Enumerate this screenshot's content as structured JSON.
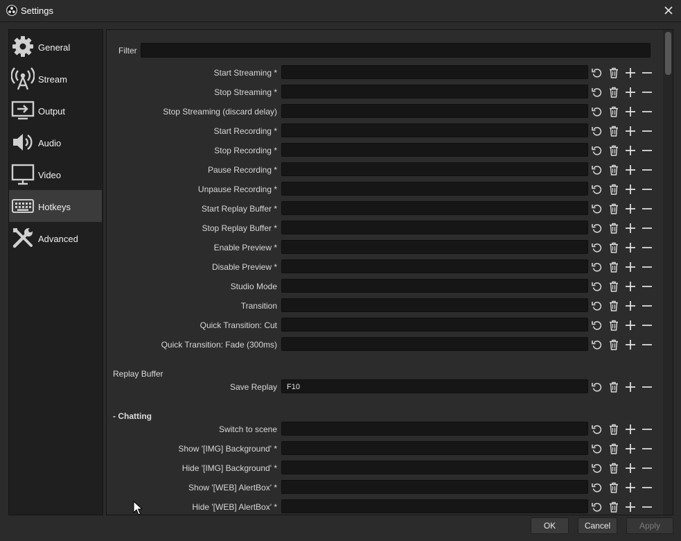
{
  "window": {
    "title": "Settings"
  },
  "sidebar": {
    "items": [
      {
        "label": "General",
        "icon": "gear-icon"
      },
      {
        "label": "Stream",
        "icon": "antenna-icon"
      },
      {
        "label": "Output",
        "icon": "output-icon"
      },
      {
        "label": "Audio",
        "icon": "speaker-icon"
      },
      {
        "label": "Video",
        "icon": "monitor-icon"
      },
      {
        "label": "Hotkeys",
        "icon": "keyboard-icon",
        "active": true
      },
      {
        "label": "Advanced",
        "icon": "tools-icon"
      }
    ]
  },
  "filter": {
    "label": "Filter",
    "value": ""
  },
  "hotkeys": [
    {
      "label": "Start Streaming *",
      "value": ""
    },
    {
      "label": "Stop Streaming *",
      "value": ""
    },
    {
      "label": "Stop Streaming (discard delay)",
      "value": ""
    },
    {
      "label": "Start Recording *",
      "value": ""
    },
    {
      "label": "Stop Recording *",
      "value": ""
    },
    {
      "label": "Pause Recording *",
      "value": ""
    },
    {
      "label": "Unpause Recording *",
      "value": ""
    },
    {
      "label": "Start Replay Buffer *",
      "value": ""
    },
    {
      "label": "Stop Replay Buffer *",
      "value": ""
    },
    {
      "label": "Enable Preview *",
      "value": ""
    },
    {
      "label": "Disable Preview *",
      "value": ""
    },
    {
      "label": "Studio Mode",
      "value": ""
    },
    {
      "label": "Transition",
      "value": ""
    },
    {
      "label": "Quick Transition: Cut",
      "value": ""
    },
    {
      "label": "Quick Transition: Fade (300ms)",
      "value": ""
    }
  ],
  "replay_buffer": {
    "section": "Replay Buffer",
    "items": [
      {
        "label": "Save Replay",
        "value": "F10"
      }
    ]
  },
  "chatting": {
    "section": "- Chatting",
    "items": [
      {
        "label": "Switch to scene",
        "value": ""
      },
      {
        "label": "Show '[IMG] Background' *",
        "value": ""
      },
      {
        "label": "Hide '[IMG] Background' *",
        "value": ""
      },
      {
        "label": "Show '[WEB] AlertBox' *",
        "value": ""
      },
      {
        "label": "Hide '[WEB] AlertBox' *",
        "value": ""
      }
    ]
  },
  "buttons": {
    "ok": "OK",
    "cancel": "Cancel",
    "apply": "Apply"
  },
  "colors": {
    "background": "#2b2b2b",
    "sidebar": "#1f1f1f",
    "active_item": "#3b3b3b",
    "input": "#161616"
  }
}
